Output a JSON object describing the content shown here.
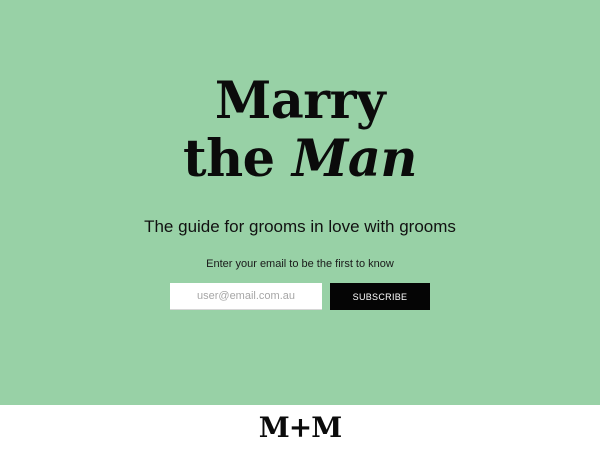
{
  "hero": {
    "title_line1": "Marry",
    "title_line2_prefix": "the ",
    "title_line2_emph": "Man",
    "tagline": "The guide for grooms in love with grooms",
    "prompt": "Enter your email to be the first to know",
    "background_color": "#98d1a6"
  },
  "form": {
    "email_placeholder": "user@email.com.au",
    "email_value": "",
    "subscribe_label": "SUBSCRIBE"
  },
  "footer": {
    "logo_text": "M+M"
  }
}
